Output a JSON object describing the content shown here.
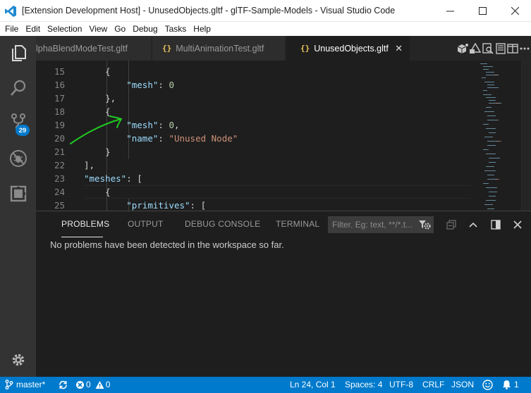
{
  "window": {
    "title": "[Extension Development Host] - UnusedObjects.gltf - glTF-Sample-Models - Visual Studio Code"
  },
  "menu": {
    "items": [
      {
        "label": "File"
      },
      {
        "label": "Edit"
      },
      {
        "label": "Selection"
      },
      {
        "label": "View"
      },
      {
        "label": "Go"
      },
      {
        "label": "Debug"
      },
      {
        "label": "Tasks"
      },
      {
        "label": "Help"
      }
    ]
  },
  "activity": {
    "icons": [
      "explorer-icon",
      "search-icon",
      "source-control-icon",
      "debug-icon",
      "extensions-icon",
      "gear-icon"
    ],
    "scm_badge": "29"
  },
  "tabs": [
    {
      "label": "lphaBlendModeTest.gltf",
      "active": false
    },
    {
      "label": "MultiAnimationTest.gltf",
      "active": false,
      "icon_text": "{}"
    },
    {
      "label": "UnusedObjects.gltf",
      "active": true,
      "icon_text": "{}"
    }
  ],
  "tab_close_glyph": "✕",
  "editor": {
    "lines": [
      {
        "num": "15",
        "indent": "    ",
        "parts": [
          {
            "t": "{",
            "c": "p"
          }
        ]
      },
      {
        "num": "16",
        "indent": "        ",
        "parts": [
          {
            "t": "\"mesh\"",
            "c": "k"
          },
          {
            "t": ": ",
            "c": "p"
          },
          {
            "t": "0",
            "c": "n"
          }
        ]
      },
      {
        "num": "17",
        "indent": "    ",
        "parts": [
          {
            "t": "},",
            "c": "p"
          }
        ]
      },
      {
        "num": "18",
        "indent": "    ",
        "parts": [
          {
            "t": "{",
            "c": "p"
          }
        ]
      },
      {
        "num": "19",
        "indent": "        ",
        "parts": [
          {
            "t": "\"mesh\"",
            "c": "k"
          },
          {
            "t": ": ",
            "c": "p"
          },
          {
            "t": "0",
            "c": "n"
          },
          {
            "t": ",",
            "c": "p"
          }
        ]
      },
      {
        "num": "20",
        "indent": "        ",
        "parts": [
          {
            "t": "\"name\"",
            "c": "k"
          },
          {
            "t": ": ",
            "c": "p"
          },
          {
            "t": "\"Unused Node\"",
            "c": "s"
          }
        ]
      },
      {
        "num": "21",
        "indent": "    ",
        "parts": [
          {
            "t": "}",
            "c": "p"
          }
        ]
      },
      {
        "num": "22",
        "indent": "",
        "parts": [
          {
            "t": "],",
            "c": "p"
          }
        ]
      },
      {
        "num": "23",
        "indent": "",
        "parts": [
          {
            "t": "\"meshes\"",
            "c": "k"
          },
          {
            "t": ": [",
            "c": "p"
          }
        ]
      },
      {
        "num": "24",
        "indent": "    ",
        "parts": [
          {
            "t": "{",
            "c": "p"
          }
        ]
      },
      {
        "num": "25",
        "indent": "        ",
        "parts": [
          {
            "t": "\"primitives\"",
            "c": "k"
          },
          {
            "t": ": [",
            "c": "p"
          }
        ]
      }
    ],
    "annotation_color": "#22c922"
  },
  "panel": {
    "tabs": [
      {
        "label": "PROBLEMS",
        "active": true
      },
      {
        "label": "OUTPUT",
        "active": false
      },
      {
        "label": "DEBUG CONSOLE",
        "active": false
      },
      {
        "label": "TERMINAL",
        "active": false
      }
    ],
    "filter_placeholder": "Filter. Eg: text, **/*.t...",
    "message": "No problems have been detected in the workspace so far."
  },
  "status": {
    "branch": "master*",
    "errors": "0",
    "warnings": "0",
    "position": "Ln 24, Col 1",
    "spaces": "Spaces: 4",
    "encoding": "UTF-8",
    "eol": "CRLF",
    "language": "JSON",
    "notifications": "1"
  },
  "colors": {
    "accent": "#007acc",
    "activity_bar": "#333333",
    "editor_bg": "#1e1e1e",
    "json_key": "#9cdcfe",
    "json_number": "#b5cea8",
    "json_string": "#ce9178"
  }
}
